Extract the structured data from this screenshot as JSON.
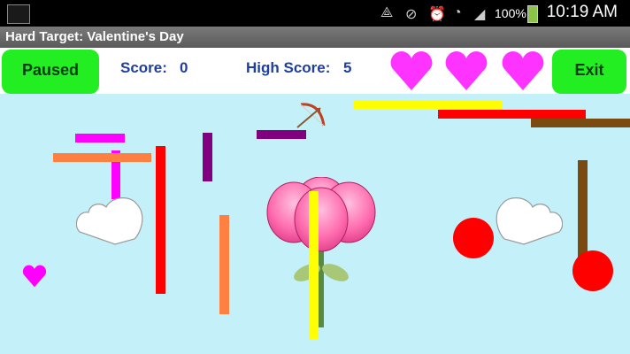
{
  "status_bar": {
    "battery": "100%",
    "time": "10:19 AM"
  },
  "app_title": "Hard Target: Valentine's Day",
  "hud": {
    "pause_label": "Paused",
    "score_label": "Score:",
    "score_value": "0",
    "high_score_label": "High Score:",
    "high_score_value": "5",
    "lives_remaining": 3,
    "exit_label": "Exit"
  },
  "colors": {
    "button_green": "#22ee22",
    "heart": "#ff33ff",
    "sky": "#c4f1f9",
    "hud_text": "#1f3fa0"
  },
  "icons": [
    "gallery-icon",
    "bow-and-arrow-icon",
    "heart-icon",
    "cloud-heart-icon",
    "flower-icon"
  ]
}
